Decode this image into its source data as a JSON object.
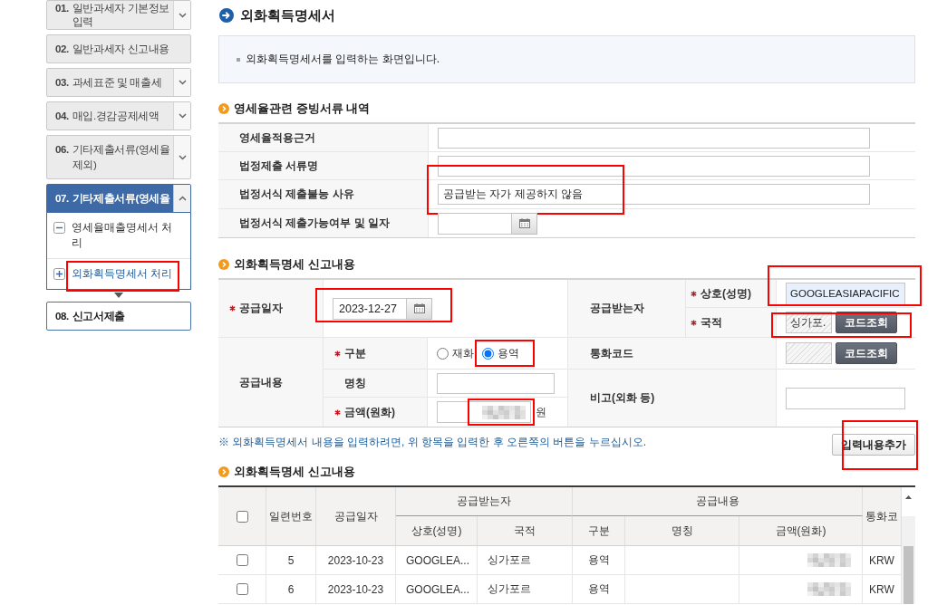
{
  "sidebar": {
    "steps": [
      {
        "number": "01.",
        "label": "일반과세자 기본정보 입력",
        "kind": "group",
        "expanded": false,
        "selected": false
      },
      {
        "number": "02.",
        "label": "일반과세자 신고내용",
        "kind": "link",
        "selected": false
      },
      {
        "number": "03.",
        "label": "과세표준 및 매출세",
        "kind": "group",
        "expanded": false,
        "selected": false
      },
      {
        "number": "04.",
        "label": "매입.경감공제세액",
        "kind": "group",
        "expanded": false,
        "selected": false
      },
      {
        "number": "06.",
        "label": "기타제출서류(영세율 제외)",
        "kind": "group",
        "expanded": false,
        "selected": false
      },
      {
        "number": "07.",
        "label": "기타제출서류(영세율",
        "kind": "group",
        "expanded": true,
        "selected": true,
        "children": [
          {
            "label": "영세율매출명세서 처리",
            "expanded": true,
            "selected": false,
            "highlighted": false
          },
          {
            "label": "외화획득명세서 처리",
            "expanded": false,
            "selected": true,
            "highlighted": true
          }
        ]
      },
      {
        "number": "08.",
        "label": "신고서제출",
        "kind": "final",
        "selected": false
      }
    ]
  },
  "page_title": "외화획득명세서",
  "info": {
    "text": "외화획득명세서를 입력하는 화면입니다."
  },
  "evidence_section": {
    "heading": "영세율관련 증빙서류 내역",
    "rows": [
      {
        "label": "영세율적용근거",
        "kind": "text",
        "highlighted": false
      },
      {
        "label": "법정제출 서류명",
        "kind": "text",
        "highlighted": false
      },
      {
        "label": "법정서식 제출불능 사유",
        "kind": "text",
        "value": "공급받는 자가 제공하지 않음",
        "highlighted": true
      },
      {
        "label": "법정서식 제출가능여부 및 일자",
        "kind": "date",
        "highlighted": false
      }
    ]
  },
  "report_section": {
    "heading": "외화획득명세 신고내용",
    "supply_date": {
      "label": "공급일자",
      "required": true,
      "value": "2023-12-27",
      "highlighted": true
    },
    "recipient": {
      "label": "공급받는자",
      "trade_name": {
        "label": "상호(성명)",
        "required": true,
        "value": "GOOGLEASIAPACIFIC",
        "autofilled": true,
        "highlighted": true
      },
      "nationality": {
        "label": "국적",
        "required": true,
        "value": "싱가포.",
        "button": "코드조회",
        "highlighted": true
      }
    },
    "supply_content": {
      "label": "공급내용",
      "required": false,
      "type": {
        "label": "구분",
        "required": true,
        "options": [
          {
            "label": "재화",
            "selected": false,
            "highlighted": false
          },
          {
            "label": "용역",
            "selected": true,
            "highlighted": true
          }
        ]
      },
      "name": {
        "label": "명칭",
        "required": false
      },
      "amount": {
        "label": "금액(원화)",
        "required": true,
        "redacted": true,
        "unit": "원",
        "highlighted": true
      }
    },
    "currency_code": {
      "label": "통화코드",
      "button": "코드조회"
    },
    "remarks": {
      "label": "비고(외화 등)"
    },
    "note": "※ 외화획득명세서 내용을 입력하려면, 위 항목을 입력한 후 오른쪽의 버튼을 누르십시오.",
    "add_button": {
      "label": "입력내용추가",
      "highlighted": true
    }
  },
  "list_section": {
    "heading": "외화획득명세 신고내용",
    "table": {
      "select_all": {
        "checked": false
      },
      "header": [
        {
          "label": "일련번호"
        },
        {
          "label": "공급일자"
        },
        {
          "label": "공급받는자",
          "children": [
            {
              "label": "상호(성명)"
            },
            {
              "label": "국적"
            }
          ]
        },
        {
          "label": "공급내용",
          "children": [
            {
              "label": "구분"
            },
            {
              "label": "명칭"
            },
            {
              "label": "금액(원화)"
            }
          ]
        },
        {
          "label": "통화코"
        }
      ],
      "rows": [
        {
          "checked": false,
          "serial": "5",
          "supply_date": "2023-10-23",
          "trade_name": "GOOGLEA...",
          "nationality": "싱가포르",
          "type": "용역",
          "amount_redacted": true,
          "currency": "KRW"
        },
        {
          "checked": false,
          "serial": "6",
          "supply_date": "2023-10-23",
          "trade_name": "GOOGLEA...",
          "nationality": "싱가포르",
          "type": "용역",
          "amount_redacted": true,
          "currency": "KRW"
        }
      ]
    }
  }
}
